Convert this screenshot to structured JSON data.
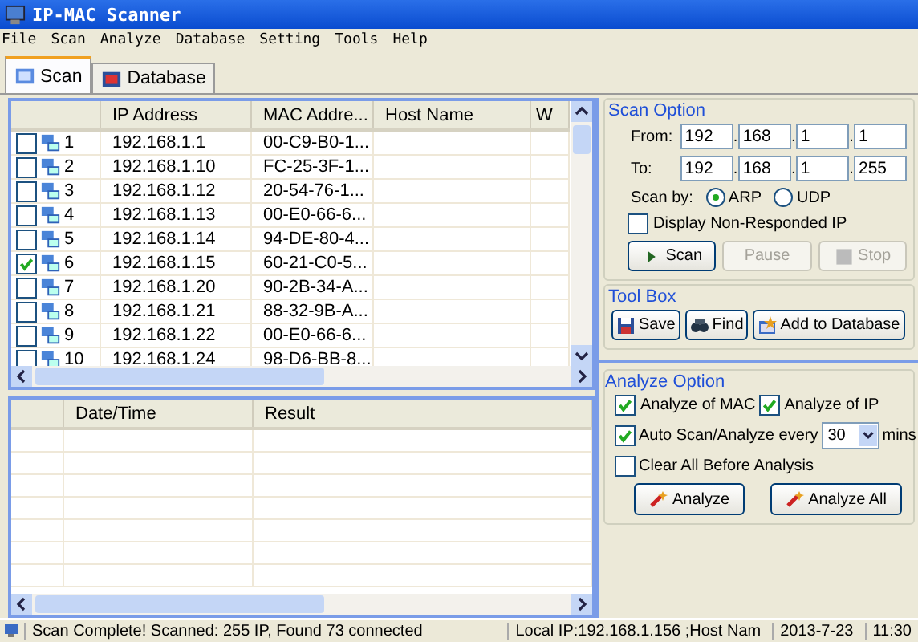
{
  "window": {
    "title": "IP-MAC Scanner"
  },
  "menu": [
    "File",
    "Scan",
    "Analyze",
    "Database",
    "Setting",
    "Tools",
    "Help"
  ],
  "tabs": [
    {
      "label": "Scan",
      "selected": true
    },
    {
      "label": "Database",
      "selected": false
    }
  ],
  "scan_table": {
    "columns": [
      "IP Address",
      "MAC Addre...",
      "Host Name",
      "W"
    ],
    "rows": [
      {
        "checked": false,
        "index": "1",
        "ip": "192.168.1.1",
        "mac": "00-C9-B0-1..."
      },
      {
        "checked": false,
        "index": "2",
        "ip": "192.168.1.10",
        "mac": "FC-25-3F-1..."
      },
      {
        "checked": false,
        "index": "3",
        "ip": "192.168.1.12",
        "mac": "20-54-76-1..."
      },
      {
        "checked": false,
        "index": "4",
        "ip": "192.168.1.13",
        "mac": "00-E0-66-6..."
      },
      {
        "checked": false,
        "index": "5",
        "ip": "192.168.1.14",
        "mac": "94-DE-80-4..."
      },
      {
        "checked": true,
        "index": "6",
        "ip": "192.168.1.15",
        "mac": "60-21-C0-5..."
      },
      {
        "checked": false,
        "index": "7",
        "ip": "192.168.1.20",
        "mac": "90-2B-34-A..."
      },
      {
        "checked": false,
        "index": "8",
        "ip": "192.168.1.21",
        "mac": "88-32-9B-A..."
      },
      {
        "checked": false,
        "index": "9",
        "ip": "192.168.1.22",
        "mac": "00-E0-66-6..."
      },
      {
        "checked": false,
        "index": "10",
        "ip": "192.168.1.24",
        "mac": "98-D6-BB-8..."
      }
    ]
  },
  "scan_option": {
    "title": "Scan Option",
    "from_label": "From:",
    "from": [
      "192",
      "168",
      "1",
      "1"
    ],
    "to_label": "To:",
    "to": [
      "192",
      "168",
      "1",
      "255"
    ],
    "separator": ".",
    "scan_by_label": "Scan by:",
    "methods": [
      {
        "label": "ARP",
        "selected": true
      },
      {
        "label": "UDP",
        "selected": false
      }
    ],
    "display_non_responded": {
      "label": "Display Non-Responded IP",
      "checked": false
    },
    "buttons": [
      {
        "kind": "play",
        "label": "Scan",
        "disabled": false
      },
      {
        "kind": "plain",
        "label": "Pause",
        "disabled": true
      },
      {
        "kind": "stop",
        "label": "Stop",
        "disabled": true
      }
    ]
  },
  "tool_box": {
    "title": "Tool Box",
    "buttons": [
      {
        "kind": "save",
        "label": "Save"
      },
      {
        "kind": "find",
        "label": "Find"
      },
      {
        "kind": "add",
        "label": "Add to Database"
      }
    ]
  },
  "result_table": {
    "columns": [
      "Date/Time",
      "Result"
    ]
  },
  "analyze_option": {
    "title": "Analyze Option",
    "options": [
      {
        "label": "Analyze of MAC",
        "checked": true
      },
      {
        "label": "Analyze of IP",
        "checked": true
      }
    ],
    "auto": {
      "label": "Auto Scan/Analyze every",
      "checked": true,
      "interval": "30",
      "unit": "mins"
    },
    "clear_all": {
      "label": "Clear All Before Analysis",
      "checked": false
    },
    "buttons": [
      "Analyze",
      "Analyze All"
    ]
  },
  "status_bar": {
    "message": "Scan Complete! Scanned: 255 IP, Found 73 connected",
    "local_ip": "Local IP:192.168.1.156 ;Host Nam",
    "date": "2013-7-23",
    "time": "11:30"
  }
}
